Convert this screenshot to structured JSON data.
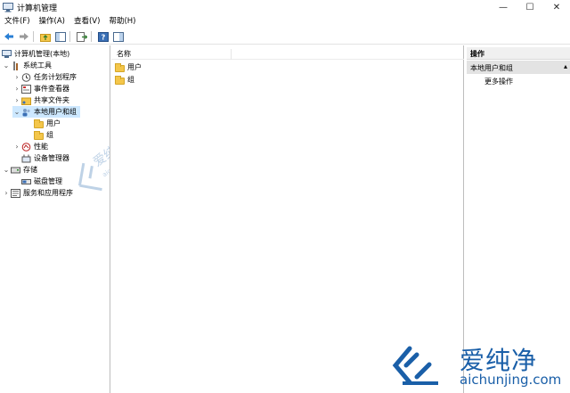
{
  "window": {
    "title": "计算机管理",
    "minimize_glyph": "—",
    "maximize_glyph": "☐",
    "close_glyph": "✕"
  },
  "menu": [
    {
      "label": "文件(F)"
    },
    {
      "label": "操作(A)"
    },
    {
      "label": "查看(V)"
    },
    {
      "label": "帮助(H)"
    }
  ],
  "toolbar": {
    "icons": [
      "back-arrow-icon",
      "forward-arrow-icon",
      "up-folder-icon",
      "show-hide-tree-icon",
      "export-list-icon",
      "help-icon",
      "show-action-pane-icon"
    ]
  },
  "tree": {
    "root": "计算机管理(本地)",
    "system_tools": "系统工具",
    "task_scheduler": "任务计划程序",
    "event_viewer": "事件查看器",
    "shared_folders": "共享文件夹",
    "local_users_groups": "本地用户和组",
    "users": "用户",
    "groups": "组",
    "performance": "性能",
    "device_manager": "设备管理器",
    "storage": "存储",
    "disk_management": "磁盘管理",
    "services_apps": "服务和应用程序"
  },
  "list": {
    "column_name": "名称",
    "items": [
      {
        "label": "用户"
      },
      {
        "label": "组"
      }
    ]
  },
  "actions": {
    "header": "操作",
    "section": "本地用户和组",
    "more": "更多操作"
  },
  "watermark": {
    "brand": "爱纯净",
    "url": "aichunjing.com"
  },
  "colors": {
    "selection": "#cde8ff",
    "folder": "#f4c64a",
    "watermark": "#1a5fa8"
  }
}
